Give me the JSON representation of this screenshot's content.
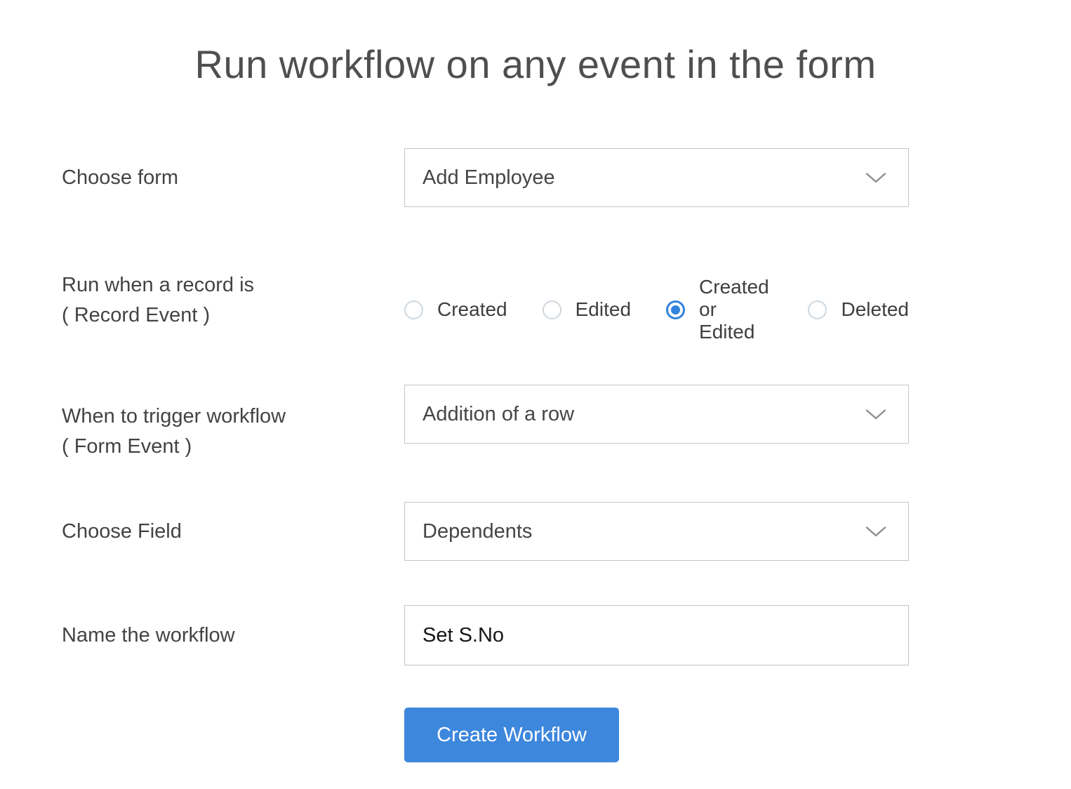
{
  "page": {
    "title": "Run workflow on any event in the form"
  },
  "form": {
    "choose_form": {
      "label": "Choose form",
      "value": "Add Employee"
    },
    "record_event": {
      "label": "Run when a record is",
      "sublabel": "( Record Event )",
      "options": [
        {
          "label": "Created",
          "selected": false
        },
        {
          "label": "Edited",
          "selected": false
        },
        {
          "label": "Created or Edited",
          "selected": true
        },
        {
          "label": "Deleted",
          "selected": false
        }
      ]
    },
    "form_event": {
      "label": "When to trigger workflow",
      "sublabel": "( Form Event )",
      "value": "Addition of a row"
    },
    "choose_field": {
      "label": "Choose Field",
      "value": "Dependents"
    },
    "workflow_name": {
      "label": "Name the workflow",
      "value": "Set S.No"
    },
    "submit_label": "Create Workflow"
  },
  "icons": {
    "dropdown_icon_name": "chevron-down-icon"
  },
  "colors": {
    "accent_blue": "#3d87dd",
    "radio_selected_blue": "#3283dd",
    "field_border": "#c6c6c6",
    "label_text": "#434343",
    "title_text": "#4f4f4f",
    "input_text": "#161616",
    "chevron": "#8f8f8f"
  }
}
